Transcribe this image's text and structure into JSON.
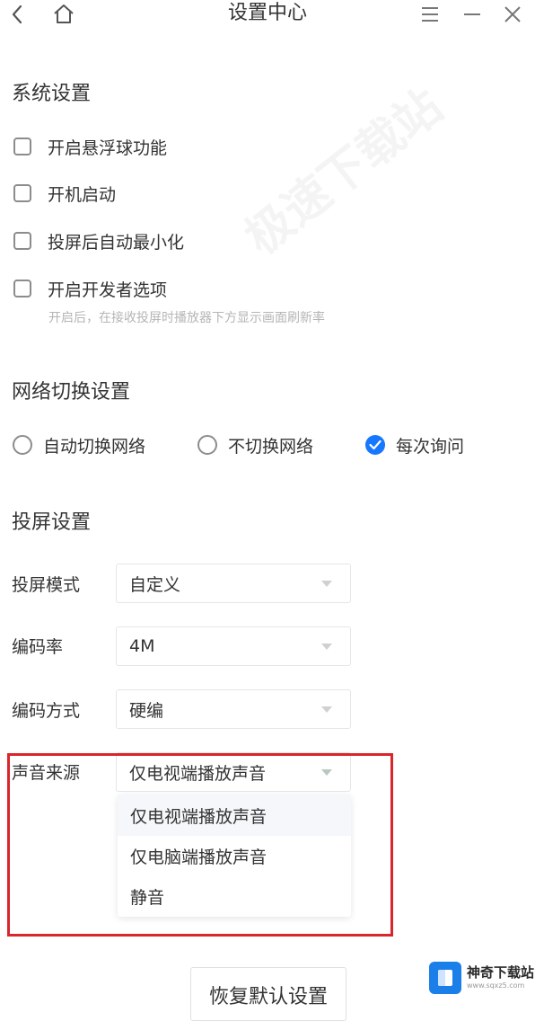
{
  "titlebar": {
    "title": "设置中心",
    "icons": [
      "back-icon",
      "home-icon",
      "menu-icon",
      "minimize-icon",
      "close-icon"
    ]
  },
  "system_settings": {
    "title": "系统设置",
    "options": [
      {
        "label": "开启悬浮球功能",
        "checked": false
      },
      {
        "label": "开机启动",
        "checked": false
      },
      {
        "label": "投屏后自动最小化",
        "checked": false
      },
      {
        "label": "开启开发者选项",
        "checked": false
      }
    ],
    "developer_hint": "开启后，在接收投屏时播放器下方显示画面刷新率"
  },
  "network_settings": {
    "title": "网络切换设置",
    "options": [
      {
        "label": "自动切换网络",
        "selected": false
      },
      {
        "label": "不切换网络",
        "selected": false
      },
      {
        "label": "每次询问",
        "selected": true
      }
    ]
  },
  "cast_settings": {
    "title": "投屏设置",
    "fields": [
      {
        "label": "投屏模式",
        "value": "自定义"
      },
      {
        "label": "编码率",
        "value": "4M"
      },
      {
        "label": "编码方式",
        "value": "硬编"
      },
      {
        "label": "声音来源",
        "value": "仅电视端播放声音"
      }
    ],
    "audio_options": [
      "仅电视端播放声音",
      "仅电脑端播放声音",
      "静音"
    ]
  },
  "reset_button": "恢复默认设置",
  "watermark": {
    "text": "极速下载站"
  },
  "logo": {
    "name": "神奇下载站",
    "url": "www.sqxz5.com"
  },
  "colors": {
    "accent": "#1677ff",
    "highlight_border": "#d9252b",
    "hint_text": "#b5b5b5"
  }
}
